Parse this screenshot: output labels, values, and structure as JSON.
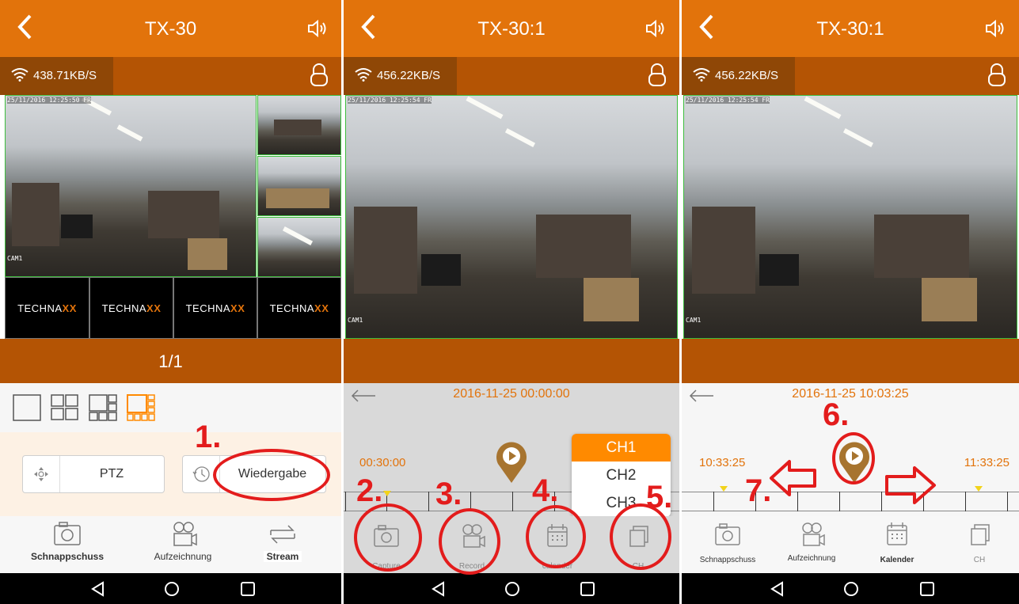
{
  "phone1": {
    "title": "TX-30",
    "rate": "438.71KB/S",
    "timestamp": "25/11/2016 12:25:50 FR",
    "cam_id": "CAM1",
    "logo_tiles": [
      "TECHNA",
      "TECHNA",
      "TECHNA",
      "TECHNA"
    ],
    "logo_suffix": "XX",
    "page": "1/1",
    "ptz_label": "PTZ",
    "playback_label": "Wiedergabe",
    "nav": [
      "Schnappschuss",
      "Aufzeichnung",
      "Stream"
    ],
    "annotation": "1."
  },
  "phone2": {
    "title": "TX-30:1",
    "rate": "456.22KB/S",
    "timestamp": "25/11/2016 12:25:54 FR",
    "cam_id": "CAM1",
    "date": "2016-11-25 00:00:00",
    "time_left": "00:30:00",
    "channels": [
      "CH1",
      "CH2",
      "CH3"
    ],
    "nav": [
      "Capture",
      "Record",
      "calender",
      "CH"
    ],
    "annotations": [
      "2.",
      "3.",
      "4.",
      "5."
    ]
  },
  "phone3": {
    "title": "TX-30:1",
    "rate": "456.22KB/S",
    "timestamp": "25/11/2016 12:25:54 FR",
    "cam_id": "CAM1",
    "date": "2016-11-25 10:03:25",
    "time_left": "10:33:25",
    "time_right": "11:33:25",
    "nav": [
      "Schnappschuss",
      "Aufzeichnung",
      "Kalender",
      "CH"
    ],
    "annotations": [
      "6.",
      "7."
    ]
  },
  "colors": {
    "header": "#e2730b",
    "status": "#b45404",
    "annotation": "#e31c1c"
  }
}
